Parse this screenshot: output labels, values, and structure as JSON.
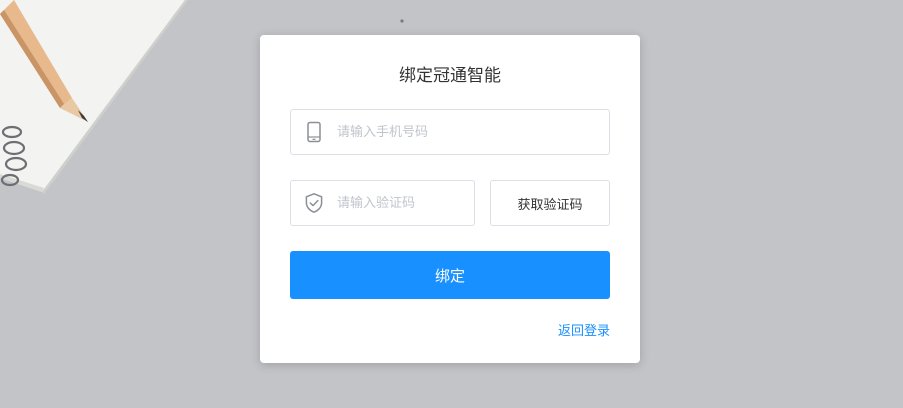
{
  "colors": {
    "background": "#c3c4c8",
    "card": "#ffffff",
    "accent": "#1890ff",
    "border": "#dcdfe6",
    "placeholder": "#c0c4cc"
  },
  "form": {
    "title": "绑定冠通智能",
    "phone": {
      "icon": "mobile-phone-icon",
      "placeholder": "请输入手机号码",
      "value": ""
    },
    "code": {
      "icon": "shield-check-icon",
      "placeholder": "请输入验证码",
      "value": ""
    },
    "get_code_label": "获取验证码",
    "submit_label": "绑定",
    "back_label": "返回登录"
  }
}
